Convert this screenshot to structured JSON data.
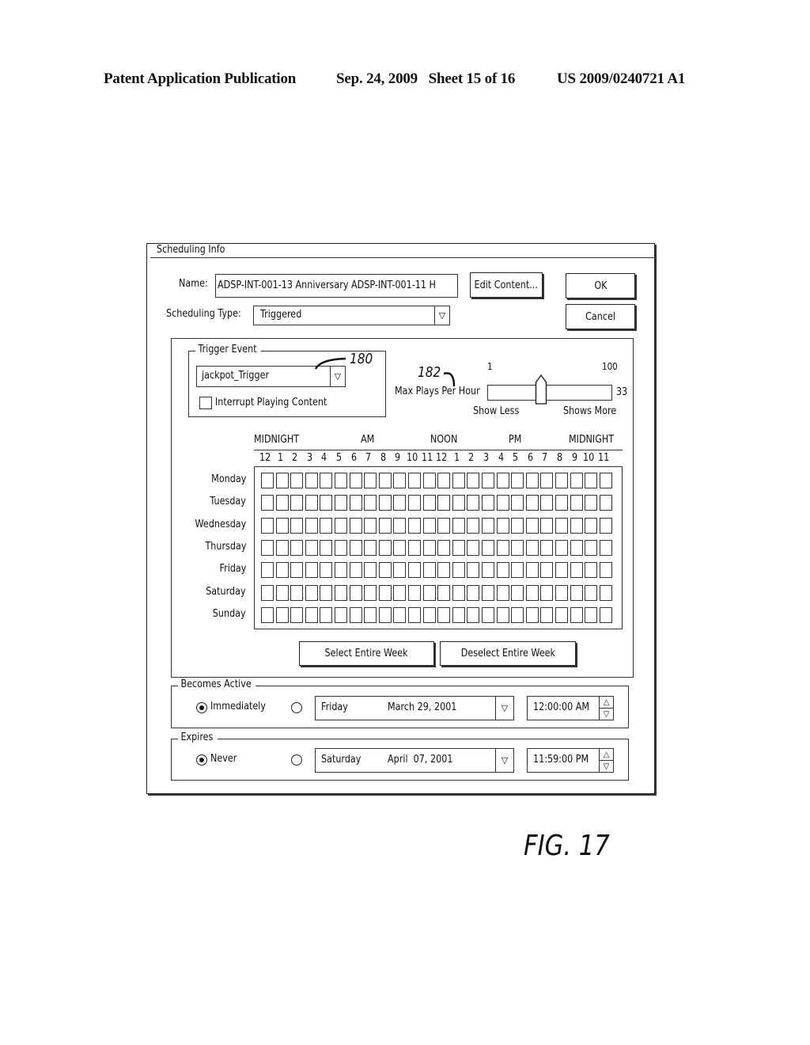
{
  "header": {
    "publication": "Patent Application Publication",
    "date_sheet": "Sep. 24, 2009   Sheet 15 of 16",
    "number": "US 2009/0240721 A1"
  },
  "dialog": {
    "title": "Scheduling Info",
    "name_label": "Name:",
    "name_value": "ADSP-INT-001-13 Anniversary ADSP-INT-001-11 H",
    "edit_content_label": "Edit Content...",
    "ok_label": "OK",
    "cancel_label": "Cancel",
    "scheduling_type_label": "Scheduling Type:",
    "scheduling_type_value": "Triggered",
    "trigger_event": {
      "group_label": "Trigger Event",
      "value": "jackpot_Trigger",
      "interrupt_label": "Interrupt Playing Content",
      "interrupt_checked": false,
      "ref_number": "180"
    },
    "max_plays": {
      "label": "Max Plays Per Hour",
      "min_label": "1",
      "max_label": "100",
      "value": "33",
      "min": 1,
      "max": 100,
      "less_label": "Show Less",
      "more_label": "Shows More",
      "ref_number": "182"
    },
    "schedule_grid": {
      "period_labels": [
        "MIDNIGHT",
        "AM",
        "NOON",
        "PM",
        "MIDNIGHT"
      ],
      "hours": [
        "12",
        "1",
        "2",
        "3",
        "4",
        "5",
        "6",
        "7",
        "8",
        "9",
        "10",
        "11",
        "12",
        "1",
        "2",
        "3",
        "4",
        "5",
        "6",
        "7",
        "8",
        "9",
        "10",
        "11"
      ],
      "days": [
        "Monday",
        "Tuesday",
        "Wednesday",
        "Thursday",
        "Friday",
        "Saturday",
        "Sunday"
      ],
      "selected_cells": []
    },
    "select_week_label": "Select Entire Week",
    "deselect_week_label": "Deselect Entire Week",
    "becomes_active": {
      "group_label": "Becomes Active",
      "immediately_label": "Immediately",
      "immediately_selected": true,
      "day": "Friday",
      "date": "March 29, 2001",
      "time": "12:00:00 AM"
    },
    "expires": {
      "group_label": "Expires",
      "never_label": "Never",
      "never_selected": true,
      "day": "Saturday",
      "date": "April  07, 2001",
      "time": "11:59:00 PM"
    },
    "icons": {
      "dropdown": "▽",
      "spin_up": "△",
      "spin_down": "▽"
    }
  },
  "figure_label": "FIG. 17"
}
